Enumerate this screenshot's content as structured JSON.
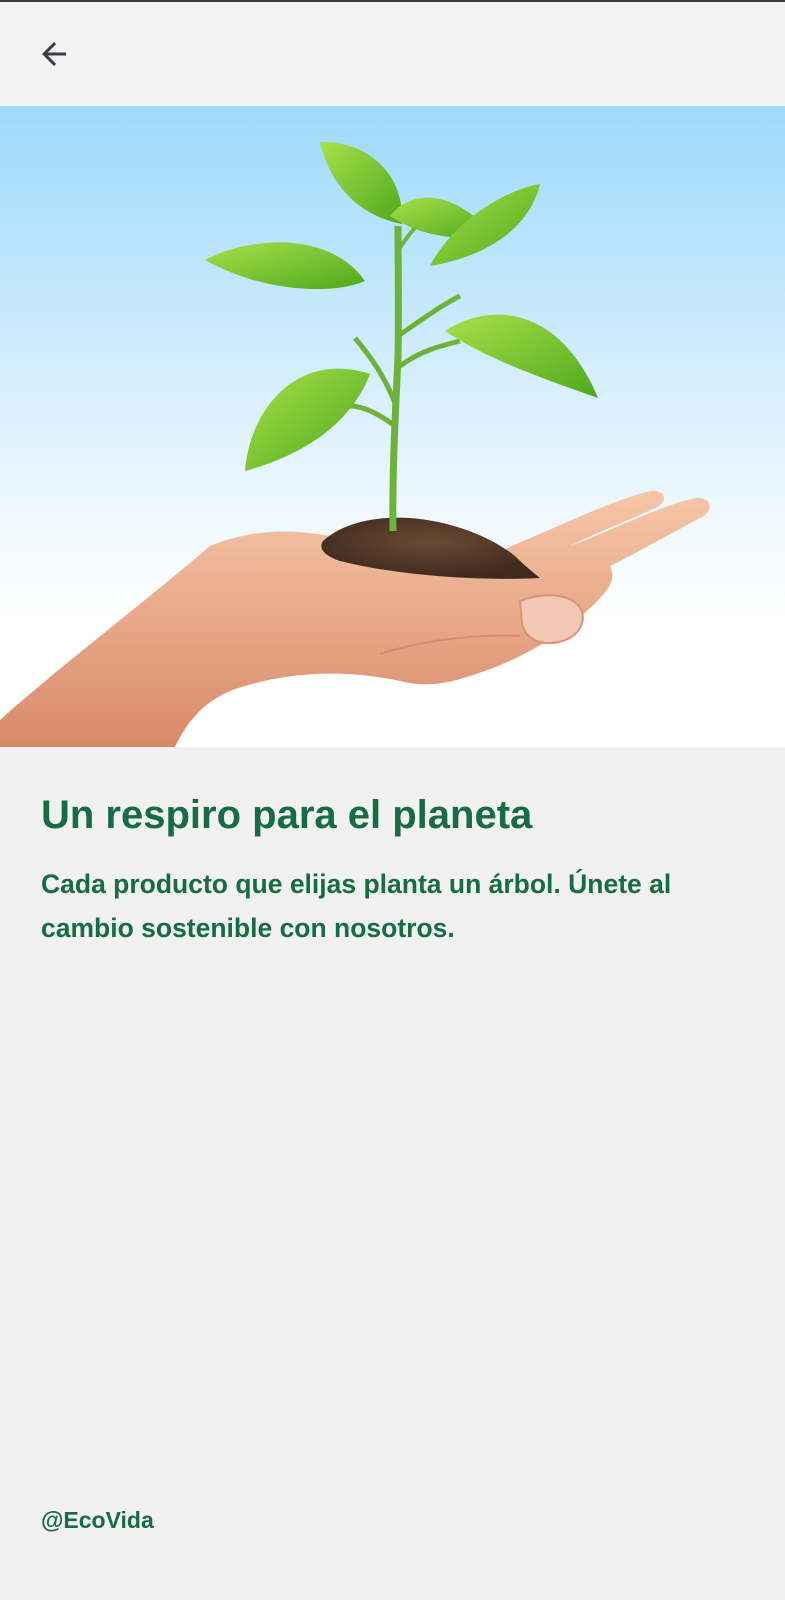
{
  "header": {
    "back_icon": "arrow-left-icon"
  },
  "hero": {
    "image_description_icon": "seedling-in-hand-illustration"
  },
  "main": {
    "title": "Un respiro para el planeta",
    "subtitle": "Cada producto que elijas planta un árbol. Únete al cambio sostenible con nosotros."
  },
  "footer": {
    "handle": "@EcoVida"
  },
  "colors": {
    "accent": "#176b45",
    "background": "#f1f1f1",
    "sky_top": "#9dd9fb",
    "leaf": "#7fcb3a"
  }
}
